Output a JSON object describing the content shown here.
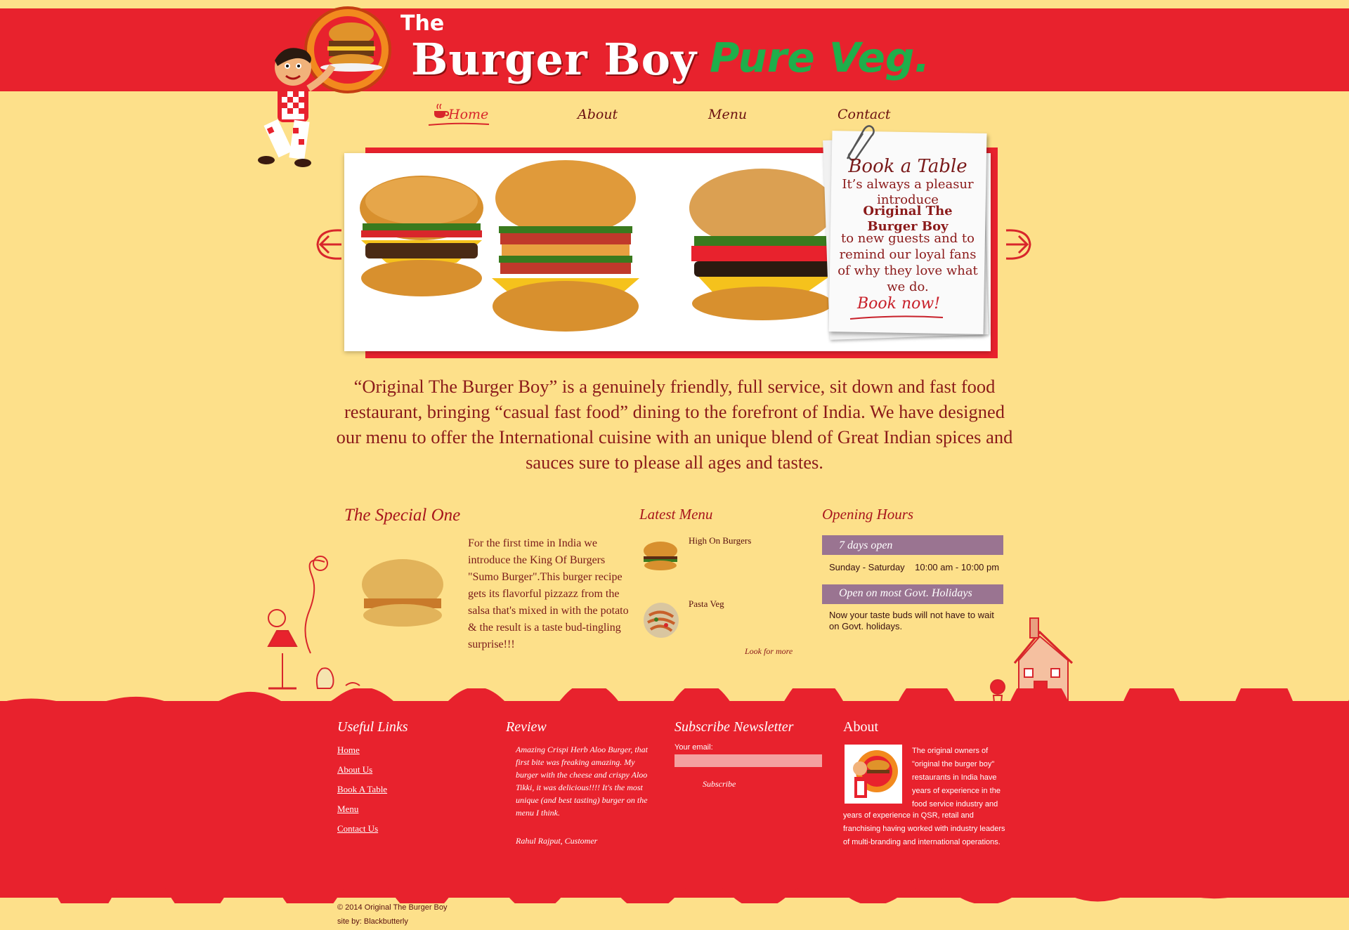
{
  "header": {
    "brand_the": "The",
    "brand_name": "Burger Boy",
    "brand_tag": "Pure Veg."
  },
  "nav": {
    "home": "Home",
    "about": "About",
    "menu": "Menu",
    "contact": "Contact"
  },
  "slider": {
    "left_arrow_icon": "arrow-left-icon",
    "right_arrow_icon": "arrow-right-icon"
  },
  "book_card": {
    "title": "Book a Table",
    "line1": "It’s always a pleasur introduce",
    "bold": "Original The Burger Boy",
    "line3": "to new guests and to remind our loyal fans of why they love what we do.",
    "cta": "Book now!"
  },
  "intro": "“Original The Burger Boy” is a genuinely friendly, full service, sit down and fast food restaurant, bringing “casual fast food” dining to the forefront of India. We have designed our menu to offer the International cuisine with an unique blend of Great Indian spices and sauces sure to please all ages and tastes.",
  "special": {
    "title": "The Special One",
    "text": "For the first time in India we introduce the King Of Burgers \"Sumo Burger\".This burger recipe gets its flavorful pizzazz from the salsa that's mixed in with the potato & the result is a taste bud-tingling surprise!!!"
  },
  "latest_menu": {
    "title": "Latest Menu",
    "items": [
      {
        "label": "High On Burgers"
      },
      {
        "label": "Pasta Veg"
      }
    ],
    "more": "Look for more"
  },
  "hours": {
    "title": "Opening Hours",
    "bar1": "7 days open",
    "days": "Sunday - Saturday    10:00 am - 10:00 pm",
    "bar2": "Open on most Govt. Holidays",
    "note": "Now your taste buds will not have to wait on Govt. holidays."
  },
  "footer": {
    "links_title": "Useful Links",
    "links": [
      "Home",
      "About Us",
      "Book A Table",
      "Menu",
      "Contact Us"
    ],
    "review_title": "Review",
    "review_text": "Amazing Crispi Herb Aloo Burger, that first bite was freaking amazing. My burger with the cheese and crispy Aloo Tikki, it was delicious!!!! It's the most unique (and best tasting) burger on the menu I think.",
    "review_author": "Rahul Rajput, Customer",
    "subscribe_title": "Subscribe Newsletter",
    "subscribe_label": "Your email:",
    "subscribe_button": "Subscribe",
    "about_title": "About",
    "about_text1": "The original owners of \"original the burger boy\" restaurants in India have years of experience in the food service industry and",
    "about_text2": "years of experience in QSR, retail and franchising having worked with industry leaders of multi-branding and international operations.",
    "copyright": "© 2014 Original The Burger Boy",
    "credit": "site by: Blackbutterly"
  },
  "colors": {
    "brand_red": "#e8222d",
    "background_yellow": "#fde08a",
    "veg_green": "#1fae4b",
    "text_maroon": "#8b1a1a",
    "hours_bar": "#9a7491"
  }
}
